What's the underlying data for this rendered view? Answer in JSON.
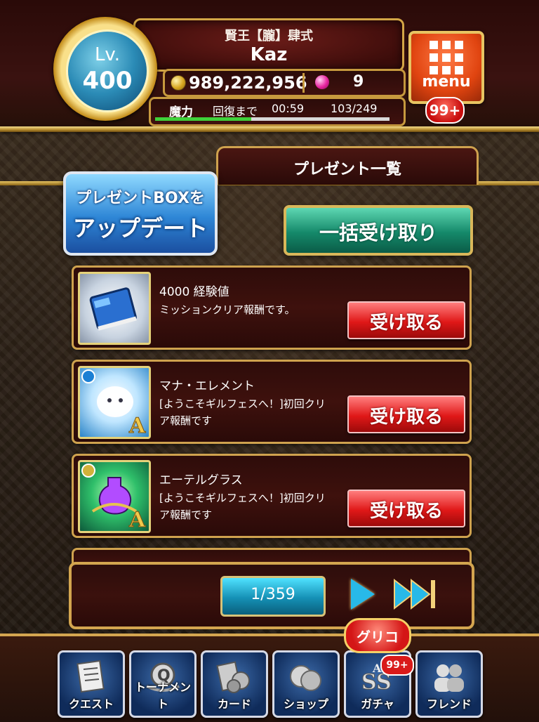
{
  "player": {
    "level_label": "Lv.",
    "level": "400",
    "title": "賢王【朧】肆式",
    "name": "Kaz",
    "gold": "989,222,956",
    "gems": "9",
    "stamina_label": "魔力",
    "recover_label": "回復まで",
    "recover_time": "00:59",
    "stamina": "103/249",
    "stamina_fraction": 0.41
  },
  "menu": {
    "label": "menu",
    "badge": "99+"
  },
  "section": {
    "title": "プレゼント一覧"
  },
  "actions": {
    "update_line1": "プレゼントBOXを",
    "update_line2": "アップデート",
    "receive_all": "一括受け取り"
  },
  "presents": [
    {
      "title": "4000 経験値",
      "desc": "ミッションクリア報酬です。",
      "button": "受け取る",
      "icon": "exp-book-icon"
    },
    {
      "title": "マナ・エレメント",
      "desc": "[ようこそギルフェスへ！]初回クリア報酬です",
      "button": "受け取る",
      "icon": "mana-element-icon"
    },
    {
      "title": "エーテルグラス",
      "desc": "[ようこそギルフェスへ！]初回クリア報酬です",
      "button": "受け取る",
      "icon": "ether-glass-icon"
    }
  ],
  "pager": {
    "page": "1/359"
  },
  "nav": {
    "quest": "クエスト",
    "tournament": "トーナメント",
    "card": "カード",
    "shop": "ショップ",
    "gacha": "ガチャ",
    "friend": "フレンド",
    "glico": "グリコ",
    "gacha_badge": "99+"
  },
  "colors": {
    "gold": "#d3a646",
    "receive_red": "#e01818",
    "receive_all_green": "#15896a",
    "update_blue": "#2e86d6"
  }
}
